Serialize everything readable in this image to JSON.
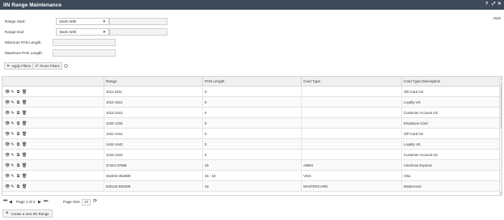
{
  "window": {
    "title": "IIN Range Maintenance",
    "controls": [
      "?",
      "⤢",
      "✕"
    ]
  },
  "hide_label": "Hide",
  "filters": {
    "range_start": {
      "label": "Range Start:",
      "operator": "Starts With",
      "value": ""
    },
    "range_end": {
      "label": "Range End:",
      "operator": "Starts With",
      "value": ""
    },
    "min_pan": {
      "label": "Minimum PAN Length:",
      "value": ""
    },
    "max_pan": {
      "label": "Maximum PAN Length:",
      "value": ""
    }
  },
  "buttons": {
    "apply": "Apply Filters",
    "reset": "Reset Filters",
    "create": "Create a new IIN Range"
  },
  "table": {
    "columns": [
      "",
      "Range",
      "PAN Length",
      "Card Type",
      "Card Type Description"
    ],
    "rows": [
      {
        "range": "1011-1011",
        "pan_length": "0",
        "card_type": "",
        "description": "Gift Card US"
      },
      {
        "range": "1012-1012",
        "pan_length": "0",
        "card_type": "",
        "description": "Loyalty US"
      },
      {
        "range": "1013-1013",
        "pan_length": "0",
        "card_type": "",
        "description": "Customer Account US"
      },
      {
        "range": "1234-1234",
        "pan_length": "0",
        "card_type": "",
        "description": "Employee Card"
      },
      {
        "range": "1441-1441",
        "pan_length": "0",
        "card_type": "",
        "description": "Gift Card UK"
      },
      {
        "range": "1442-1442",
        "pan_length": "0",
        "card_type": "",
        "description": "Loyalty UK"
      },
      {
        "range": "1443-1443",
        "pan_length": "0",
        "card_type": "",
        "description": "Customer Account UK"
      },
      {
        "range": "37424-37999",
        "pan_length": "15",
        "card_type": "AMEX",
        "description": "American Express"
      },
      {
        "range": "462404-462899",
        "pan_length": "16 - 19",
        "card_type": "VISA",
        "description": "Visa"
      },
      {
        "range": "530125-530399",
        "pan_length": "16",
        "card_type": "MASTERCARD",
        "description": "Mastercard"
      }
    ]
  },
  "pager": {
    "page_of": "Page 1 of 2",
    "page_size_label": "Page Size",
    "page_size": "10"
  }
}
